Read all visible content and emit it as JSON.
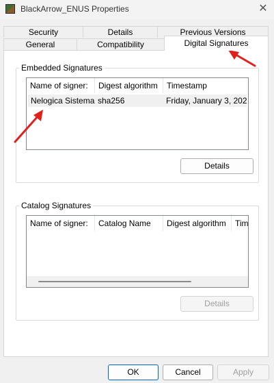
{
  "window": {
    "title": "BlackArrow_ENUS Properties"
  },
  "tabs": {
    "row1": [
      "Security",
      "Details",
      "Previous Versions"
    ],
    "row2": [
      "General",
      "Compatibility",
      "Digital Signatures"
    ],
    "active": "Digital Signatures"
  },
  "embedded": {
    "label": "Embedded Signatures",
    "columns": [
      "Name of signer:",
      "Digest algorithm",
      "Timestamp"
    ],
    "rows": [
      {
        "signer": "Nelogica Sistema...",
        "digest": "sha256",
        "timestamp": "Friday, January 3, 202..."
      }
    ],
    "details_button": "Details"
  },
  "catalog": {
    "label": "Catalog Signatures",
    "columns": [
      "Name of signer:",
      "Catalog Name",
      "Digest algorithm",
      "Time"
    ],
    "details_button": "Details"
  },
  "footer": {
    "ok": "OK",
    "cancel": "Cancel",
    "apply": "Apply"
  },
  "colors": {
    "annotation_arrow": "#e0201a"
  }
}
